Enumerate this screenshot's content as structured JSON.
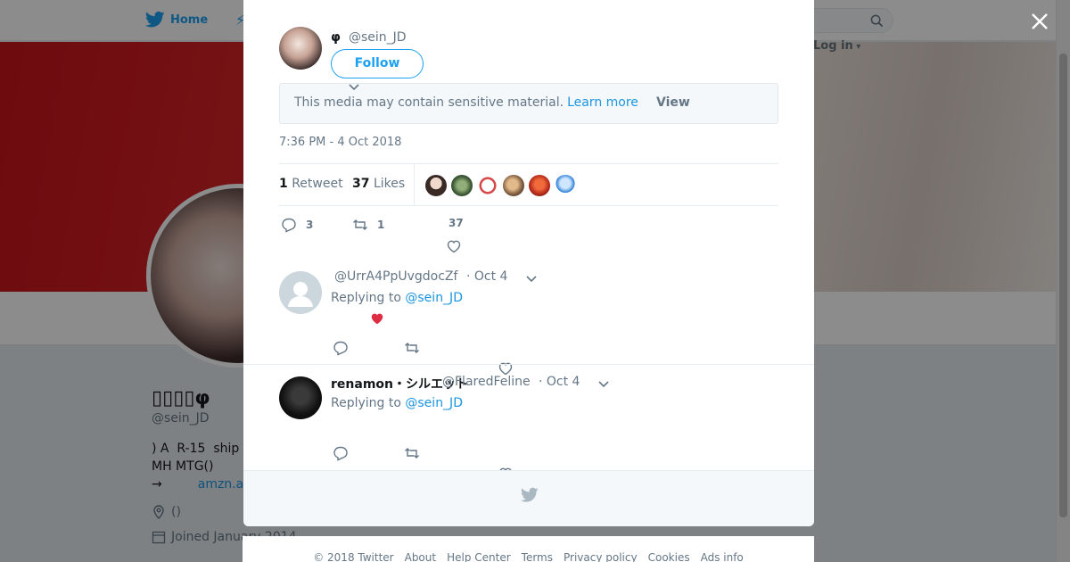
{
  "topbar": {
    "home_label": "Home",
    "login_label": "Log in"
  },
  "profile": {
    "display_name": "▯▯▯▯φ",
    "handle": "@sein_JD",
    "bio_line1": ") A  R-15  ship",
    "bio_line2": "MH MTG()",
    "bio_line3_arrow": "→",
    "bio_link": "amzn.as",
    "location": "()",
    "joined": "Joined January 2014"
  },
  "tweet": {
    "author_name": "φ",
    "author_handle": "@sein_JD",
    "follow_label": "Follow",
    "sensitive_text": "This media may contain sensitive material.",
    "learn_more": "Learn more",
    "view_label": "View",
    "timestamp": "7:36 PM - 4 Oct 2018",
    "retweets_count": "1",
    "retweets_label": "Retweet",
    "likes_count": "37",
    "likes_label": "Likes",
    "reply_count": "3",
    "retweet_count": "1",
    "like_count": "37"
  },
  "replies": [
    {
      "name": "",
      "handle": "@UrrA4PpUvgdocZf",
      "date": "· Oct 4",
      "replying_prefix": "Replying to",
      "replying_to": "@sein_JD"
    },
    {
      "name": "renamon・シルエット",
      "handle": "@FlaredFeline",
      "date": "· Oct 4",
      "replying_prefix": "Replying to",
      "replying_to": "@sein_JD"
    }
  ],
  "footer": {
    "copyright": "© 2018 Twitter",
    "about": "About",
    "help": "Help Center",
    "terms": "Terms",
    "privacy": "Privacy policy",
    "cookies": "Cookies",
    "ads": "Ads info"
  },
  "colors": {
    "accent": "#1da1f2",
    "link": "#1b95e0",
    "heart": "#e0245e"
  }
}
